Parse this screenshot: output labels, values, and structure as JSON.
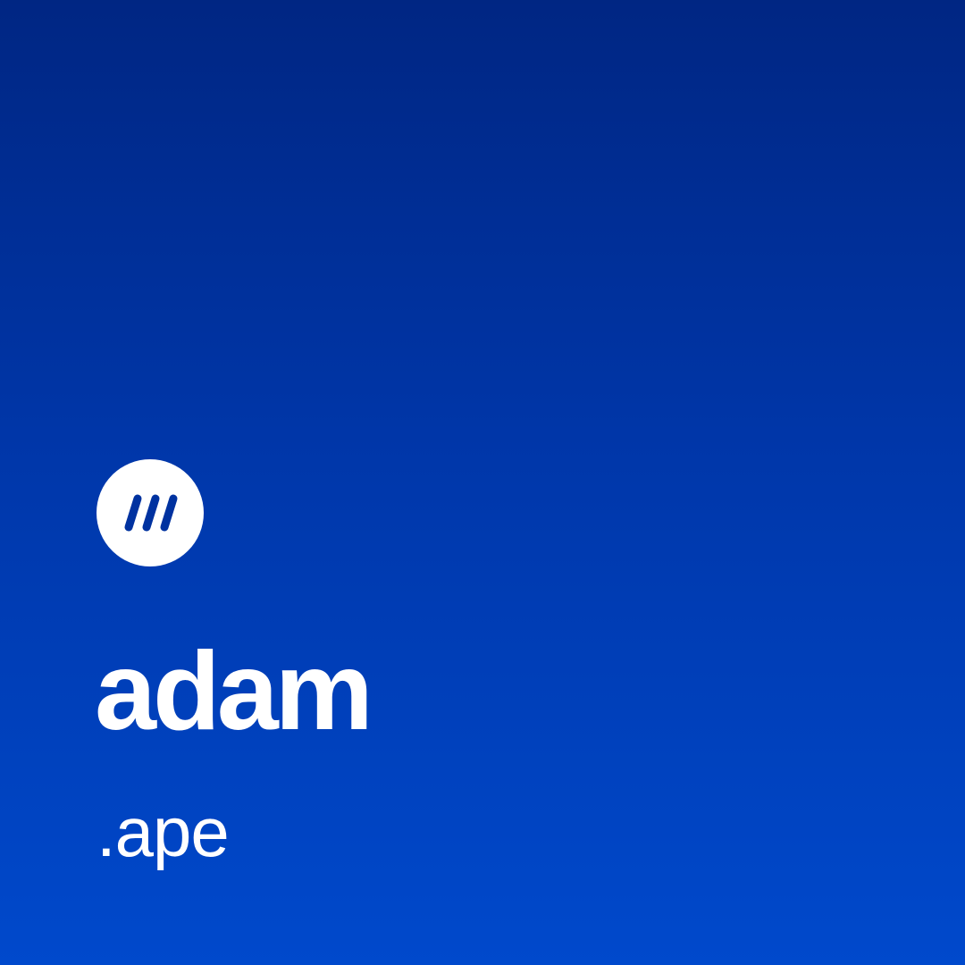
{
  "card": {
    "name": "adam",
    "tld": ".ape",
    "logo_icon": "three-slashes-logo-icon",
    "colors": {
      "background_top": "#002683",
      "background_bottom": "#0049cc",
      "text": "#ffffff",
      "logo_background": "#ffffff",
      "logo_mark": "#0032a0"
    }
  }
}
